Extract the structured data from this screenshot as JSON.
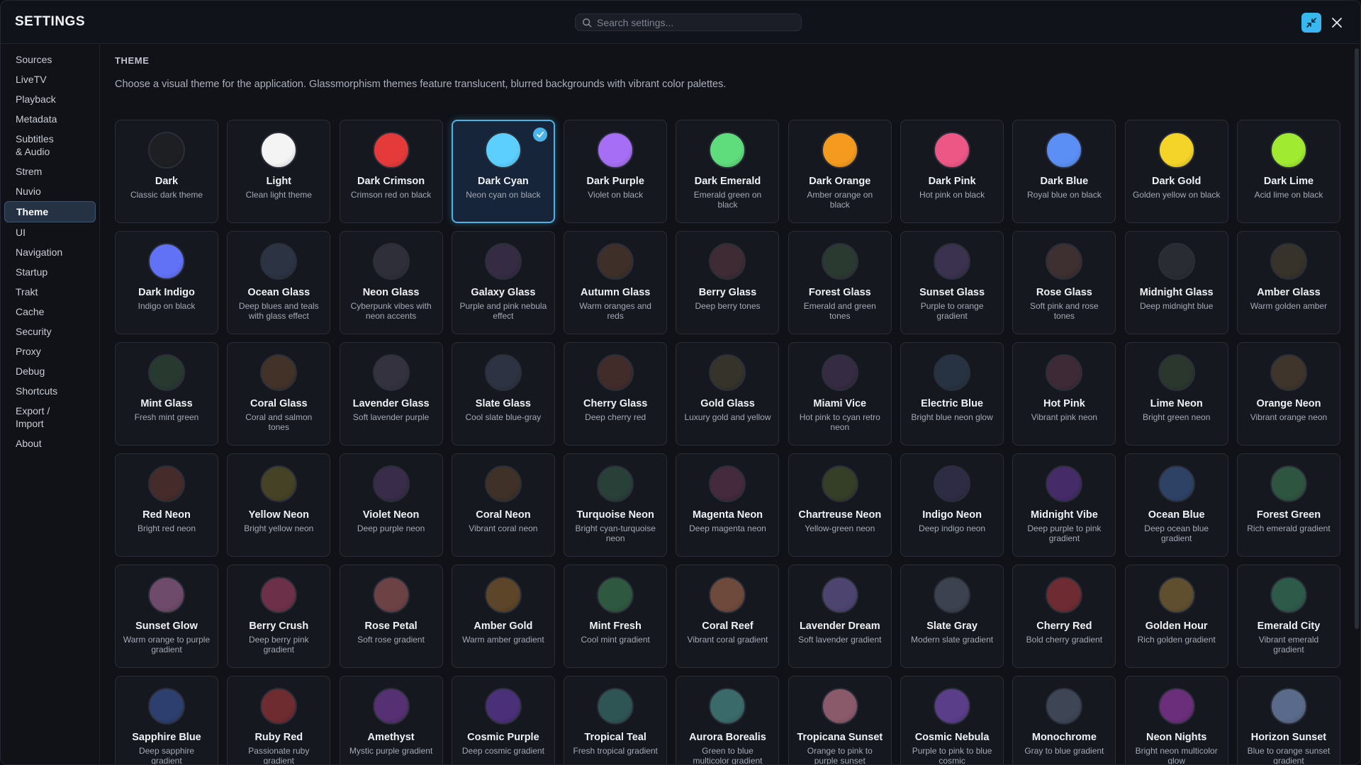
{
  "header": {
    "title": "SETTINGS",
    "search_placeholder": "Search settings..."
  },
  "sidebar": {
    "items": [
      {
        "label": "Sources",
        "active": false
      },
      {
        "label": "LiveTV",
        "active": false
      },
      {
        "label": "Playback",
        "active": false
      },
      {
        "label": "Metadata",
        "active": false
      },
      {
        "label": "Subtitles & Audio",
        "active": false
      },
      {
        "label": "Strem",
        "active": false
      },
      {
        "label": "Nuvio",
        "active": false
      },
      {
        "label": "Theme",
        "active": true
      },
      {
        "label": "UI",
        "active": false
      },
      {
        "label": "Navigation",
        "active": false
      },
      {
        "label": "Startup",
        "active": false
      },
      {
        "label": "Trakt",
        "active": false
      },
      {
        "label": "Cache",
        "active": false
      },
      {
        "label": "Security",
        "active": false
      },
      {
        "label": "Proxy",
        "active": false
      },
      {
        "label": "Debug",
        "active": false
      },
      {
        "label": "Shortcuts",
        "active": false
      },
      {
        "label": "Export / Import",
        "active": false
      },
      {
        "label": "About",
        "active": false
      }
    ]
  },
  "main": {
    "section_title": "THEME",
    "description": "Choose a visual theme for the application. Glassmorphism themes feature translucent, blurred backgrounds with vibrant color palettes.",
    "themes": [
      {
        "name": "Dark",
        "desc": "Classic dark theme",
        "color": "#1e1f22",
        "selected": false
      },
      {
        "name": "Light",
        "desc": "Clean light theme",
        "color": "#f4f4f4",
        "selected": false
      },
      {
        "name": "Dark Crimson",
        "desc": "Crimson red on black",
        "color": "#e53a3a",
        "selected": false
      },
      {
        "name": "Dark Cyan",
        "desc": "Neon cyan on black",
        "color": "#5ccfff",
        "selected": true
      },
      {
        "name": "Dark Purple",
        "desc": "Violet on black",
        "color": "#a66ef5",
        "selected": false
      },
      {
        "name": "Dark Emerald",
        "desc": "Emerald green on black",
        "color": "#5fdc7b",
        "selected": false
      },
      {
        "name": "Dark Orange",
        "desc": "Amber orange on black",
        "color": "#f39a1f",
        "selected": false
      },
      {
        "name": "Dark Pink",
        "desc": "Hot pink on black",
        "color": "#ec5785",
        "selected": false
      },
      {
        "name": "Dark Blue",
        "desc": "Royal blue on black",
        "color": "#5b8ff5",
        "selected": false
      },
      {
        "name": "Dark Gold",
        "desc": "Golden yellow on black",
        "color": "#f5d42a",
        "selected": false
      },
      {
        "name": "Dark Lime",
        "desc": "Acid lime on black",
        "color": "#a0ea32",
        "selected": false
      },
      {
        "name": "Dark Indigo",
        "desc": "Indigo on black",
        "color": "#6272f6",
        "selected": false
      },
      {
        "name": "Ocean Glass",
        "desc": "Deep blues and teals with glass effect",
        "color": "#2c3444",
        "selected": false
      },
      {
        "name": "Neon Glass",
        "desc": "Cyberpunk vibes with neon accents",
        "color": "#2e2f38",
        "selected": false
      },
      {
        "name": "Galaxy Glass",
        "desc": "Purple and pink nebula effect",
        "color": "#352c44",
        "selected": false
      },
      {
        "name": "Autumn Glass",
        "desc": "Warm oranges and reds",
        "color": "#3e3029",
        "selected": false
      },
      {
        "name": "Berry Glass",
        "desc": "Deep berry tones",
        "color": "#3e2b33",
        "selected": false
      },
      {
        "name": "Forest Glass",
        "desc": "Emerald and green tones",
        "color": "#2b3a30",
        "selected": false
      },
      {
        "name": "Sunset Glass",
        "desc": "Purple to orange gradient",
        "color": "#3b3250",
        "selected": false
      },
      {
        "name": "Rose Glass",
        "desc": "Soft pink and rose tones",
        "color": "#3e2f30",
        "selected": false
      },
      {
        "name": "Midnight Glass",
        "desc": "Deep midnight blue",
        "color": "#2a2c33",
        "selected": false
      },
      {
        "name": "Amber Glass",
        "desc": "Warm golden amber",
        "color": "#37332a",
        "selected": false
      },
      {
        "name": "Mint Glass",
        "desc": "Fresh mint green",
        "color": "#283a30",
        "selected": false
      },
      {
        "name": "Coral Glass",
        "desc": "Coral and salmon tones",
        "color": "#433228",
        "selected": false
      },
      {
        "name": "Lavender Glass",
        "desc": "Soft lavender purple",
        "color": "#35323f",
        "selected": false
      },
      {
        "name": "Slate Glass",
        "desc": "Cool slate blue-gray",
        "color": "#2d3342",
        "selected": false
      },
      {
        "name": "Cherry Glass",
        "desc": "Deep cherry red",
        "color": "#412c2a",
        "selected": false
      },
      {
        "name": "Gold Glass",
        "desc": "Luxury gold and yellow",
        "color": "#35332a",
        "selected": false
      },
      {
        "name": "Miami Vice",
        "desc": "Hot pink to cyan retro neon",
        "color": "#352b42",
        "selected": false
      },
      {
        "name": "Electric Blue",
        "desc": "Bright blue neon glow",
        "color": "#273342",
        "selected": false
      },
      {
        "name": "Hot Pink",
        "desc": "Vibrant pink neon",
        "color": "#3d2a36",
        "selected": false
      },
      {
        "name": "Lime Neon",
        "desc": "Bright green neon",
        "color": "#2b372c",
        "selected": false
      },
      {
        "name": "Orange Neon",
        "desc": "Vibrant orange neon",
        "color": "#40352a",
        "selected": false
      },
      {
        "name": "Red Neon",
        "desc": "Bright red neon",
        "color": "#452c2a",
        "selected": false
      },
      {
        "name": "Yellow Neon",
        "desc": "Bright yellow neon",
        "color": "#454226",
        "selected": false
      },
      {
        "name": "Violet Neon",
        "desc": "Deep purple neon",
        "color": "#382c4a",
        "selected": false
      },
      {
        "name": "Coral Neon",
        "desc": "Vibrant coral neon",
        "color": "#3f3128",
        "selected": false
      },
      {
        "name": "Turquoise Neon",
        "desc": "Bright cyan-turquoise neon",
        "color": "#294039",
        "selected": false
      },
      {
        "name": "Magenta Neon",
        "desc": "Deep magenta neon",
        "color": "#442a3c",
        "selected": false
      },
      {
        "name": "Chartreuse Neon",
        "desc": "Yellow-green neon",
        "color": "#353e27",
        "selected": false
      },
      {
        "name": "Indigo Neon",
        "desc": "Deep indigo neon",
        "color": "#2e2b45",
        "selected": false
      },
      {
        "name": "Midnight Vibe",
        "desc": "Deep purple to pink gradient",
        "color": "#452c69",
        "selected": false
      },
      {
        "name": "Ocean Blue",
        "desc": "Deep ocean blue gradient",
        "color": "#2e4266",
        "selected": false
      },
      {
        "name": "Forest Green",
        "desc": "Rich emerald gradient",
        "color": "#2e5540",
        "selected": false
      },
      {
        "name": "Sunset Glow",
        "desc": "Warm orange to purple gradient",
        "color": "#6e4b6a",
        "selected": false
      },
      {
        "name": "Berry Crush",
        "desc": "Deep berry pink gradient",
        "color": "#6c3148",
        "selected": false
      },
      {
        "name": "Rose Petal",
        "desc": "Soft rose gradient",
        "color": "#6c4245",
        "selected": false
      },
      {
        "name": "Amber Gold",
        "desc": "Warm amber gradient",
        "color": "#5c4528",
        "selected": false
      },
      {
        "name": "Mint Fresh",
        "desc": "Cool mint gradient",
        "color": "#2f5840",
        "selected": false
      },
      {
        "name": "Coral Reef",
        "desc": "Vibrant coral gradient",
        "color": "#6e4a3c",
        "selected": false
      },
      {
        "name": "Lavender Dream",
        "desc": "Soft lavender gradient",
        "color": "#4d4570",
        "selected": false
      },
      {
        "name": "Slate Gray",
        "desc": "Modern slate gradient",
        "color": "#3c4250",
        "selected": false
      },
      {
        "name": "Cherry Red",
        "desc": "Bold cherry gradient",
        "color": "#6e2c32",
        "selected": false
      },
      {
        "name": "Golden Hour",
        "desc": "Rich golden gradient",
        "color": "#5f4f2e",
        "selected": false
      },
      {
        "name": "Emerald City",
        "desc": "Vibrant emerald gradient",
        "color": "#2e5a4a",
        "selected": false
      },
      {
        "name": "Sapphire Blue",
        "desc": "Deep sapphire gradient",
        "color": "#2c3f6e",
        "selected": false
      },
      {
        "name": "Ruby Red",
        "desc": "Passionate ruby gradient",
        "color": "#6e2c30",
        "selected": false
      },
      {
        "name": "Amethyst",
        "desc": "Mystic purple gradient",
        "color": "#553072",
        "selected": false
      },
      {
        "name": "Cosmic Purple",
        "desc": "Deep cosmic gradient",
        "color": "#4a3078",
        "selected": false
      },
      {
        "name": "Tropical Teal",
        "desc": "Fresh tropical gradient",
        "color": "#2e5554",
        "selected": false
      },
      {
        "name": "Aurora Borealis",
        "desc": "Green to blue multicolor gradient",
        "color": "#3a6a6a",
        "selected": false
      },
      {
        "name": "Tropicana Sunset",
        "desc": "Orange to pink to purple sunset",
        "color": "#8a5a6a",
        "selected": false
      },
      {
        "name": "Cosmic Nebula",
        "desc": "Purple to pink to blue cosmic",
        "color": "#5a3e8a",
        "selected": false
      },
      {
        "name": "Monochrome",
        "desc": "Gray to blue gradient",
        "color": "#3e4656",
        "selected": false
      },
      {
        "name": "Neon Nights",
        "desc": "Bright neon multicolor glow",
        "color": "#6a2e7a",
        "selected": false
      },
      {
        "name": "Horizon Sunset",
        "desc": "Blue to orange sunset gradient",
        "color": "#5a6a8a",
        "selected": false
      }
    ]
  }
}
